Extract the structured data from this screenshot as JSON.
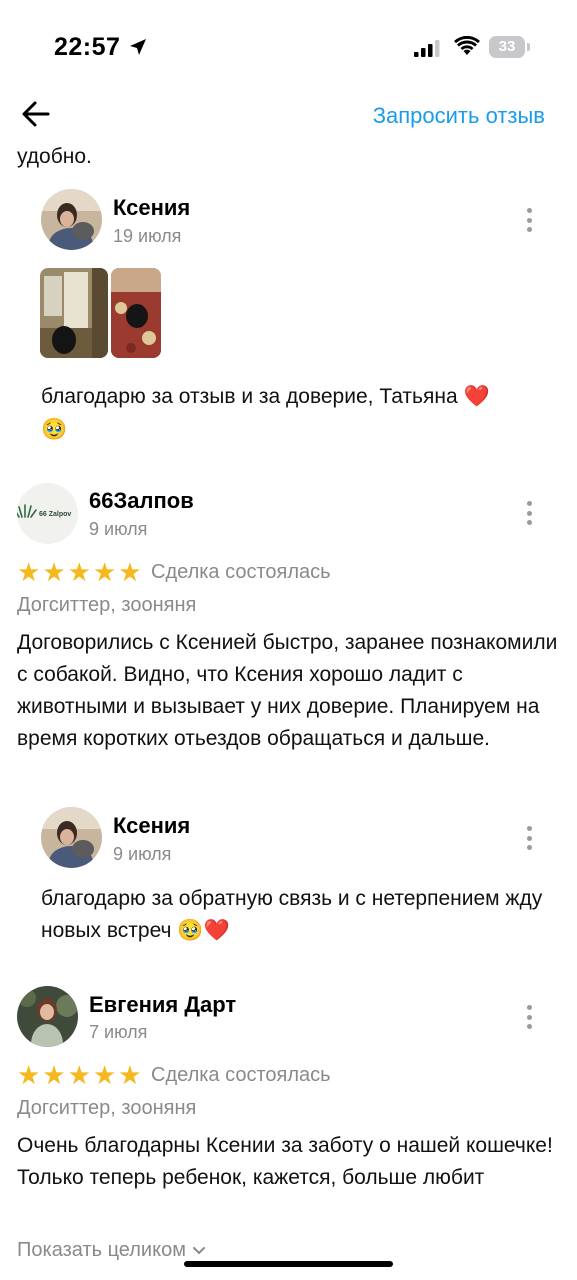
{
  "status_bar": {
    "time": "22:57",
    "battery": "33"
  },
  "header": {
    "request_review": "Запросить отзыв"
  },
  "top_fragment": "удобно.",
  "reply1": {
    "name": "Ксения",
    "date": "19 июля",
    "text": "благодарю за отзыв и за доверие, Татьяна ❤️",
    "emoji_line": "🥹"
  },
  "review1": {
    "name": "66Залпов",
    "logo_text": "66 Zalpov",
    "date": "9 июля",
    "deal_status": "Сделка состоялась",
    "category": "Догситтер, зооняня",
    "text": "Договорились с Ксенией быстро, заранее познакомили с собакой. Видно, что Ксения хорошо ладит с животными и вызывает у них доверие. Планируем на время коротких отьездов обращаться и дальше."
  },
  "reply2": {
    "name": "Ксения",
    "date": "9 июля",
    "text": "благодарю за обратную связь и с нетерпением жду новых встреч 🥹❤️"
  },
  "review2": {
    "name": "Евгения Дарт",
    "date": "7 июля",
    "deal_status": "Сделка состоялась",
    "category": "Догситтер, зооняня",
    "text": "Очень благодарны Ксении за заботу о нашей кошечке!\nТолько теперь ребенок, кажется, больше любит",
    "show_full": "Показать целиком"
  },
  "colors": {
    "accent": "#1a9de8",
    "star": "#f5b81f",
    "muted": "#8a8a8a"
  }
}
